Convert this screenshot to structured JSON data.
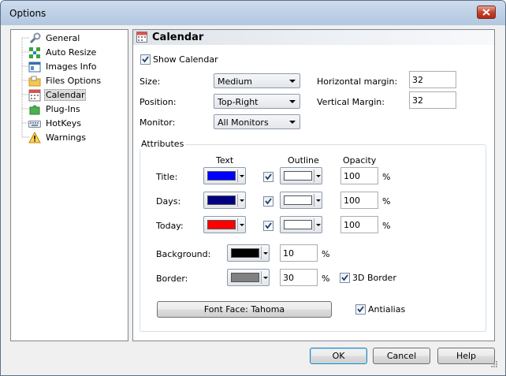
{
  "window": {
    "title": "Options"
  },
  "tree": {
    "items": [
      {
        "label": "General",
        "icon": "wrench-icon"
      },
      {
        "label": "Auto Resize",
        "icon": "resize-arrows-icon"
      },
      {
        "label": "Images Info",
        "icon": "info-window-icon"
      },
      {
        "label": "Files Options",
        "icon": "folder-icon"
      },
      {
        "label": "Calendar",
        "icon": "calendar-icon",
        "selected": true
      },
      {
        "label": "Plug-Ins",
        "icon": "puzzle-icon"
      },
      {
        "label": "HotKeys",
        "icon": "keyboard-icon"
      },
      {
        "label": "Warnings",
        "icon": "warning-icon"
      }
    ]
  },
  "panel": {
    "title": "Calendar",
    "show_calendar": {
      "label": "Show Calendar",
      "checked": true
    },
    "size": {
      "label": "Size:",
      "value": "Medium"
    },
    "position": {
      "label": "Position:",
      "value": "Top-Right"
    },
    "monitor": {
      "label": "Monitor:",
      "value": "All Monitors"
    },
    "h_margin": {
      "label": "Horizontal margin:",
      "value": "32"
    },
    "v_margin": {
      "label": "Vertical Margin:",
      "value": "32"
    },
    "attributes": {
      "title": "Attributes",
      "col_text": "Text",
      "col_outline": "Outline",
      "col_opacity": "Opacity",
      "rows": [
        {
          "label": "Title:",
          "text_color": "#0000ff",
          "outline_on": true,
          "outline_color": "#ffffff",
          "opacity": "100",
          "unit": "%"
        },
        {
          "label": "Days:",
          "text_color": "#000080",
          "outline_on": true,
          "outline_color": "#ffffff",
          "opacity": "100",
          "unit": "%"
        },
        {
          "label": "Today:",
          "text_color": "#ff0000",
          "outline_on": true,
          "outline_color": "#ffffff",
          "opacity": "100",
          "unit": "%"
        }
      ],
      "background": {
        "label": "Background:",
        "color": "#000000",
        "opacity": "10",
        "unit": "%"
      },
      "border": {
        "label": "Border:",
        "color": "#808080",
        "opacity": "30",
        "unit": "%"
      },
      "border_3d": {
        "label": "3D Border",
        "checked": true
      },
      "font_face_button": "Font Face: Tahoma",
      "antialias": {
        "label": "Antialias",
        "checked": true
      }
    }
  },
  "buttons": {
    "ok": "OK",
    "cancel": "Cancel",
    "help": "Help"
  }
}
